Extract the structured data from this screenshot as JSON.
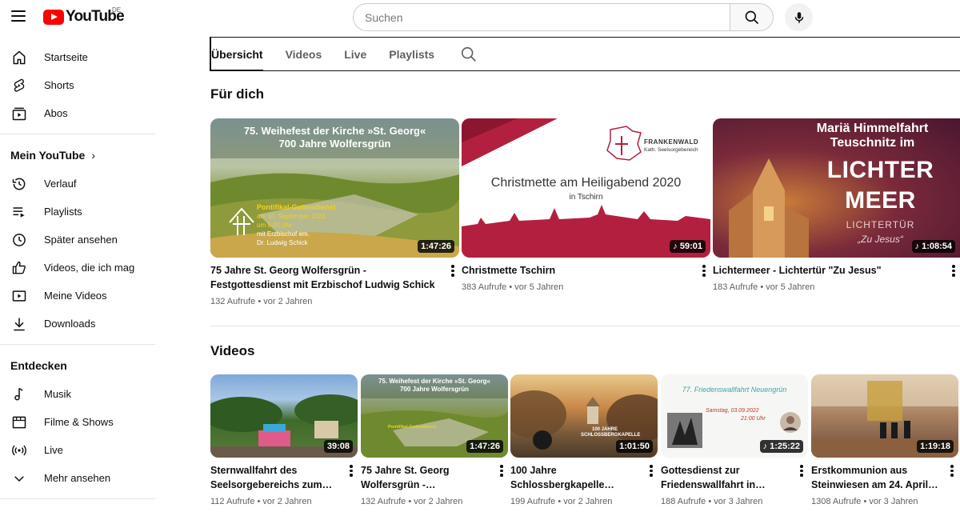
{
  "header": {
    "logo_text": "YouTube",
    "region": "DE",
    "search_placeholder": "Suchen"
  },
  "sidebar": {
    "main": [
      {
        "label": "Startseite",
        "icon": "home-icon"
      },
      {
        "label": "Shorts",
        "icon": "shorts-icon"
      },
      {
        "label": "Abos",
        "icon": "subscriptions-icon"
      }
    ],
    "you_heading": "Mein YouTube",
    "you_items": [
      {
        "label": "Verlauf",
        "icon": "history-icon"
      },
      {
        "label": "Playlists",
        "icon": "playlists-icon"
      },
      {
        "label": "Später ansehen",
        "icon": "watch-later-icon"
      },
      {
        "label": "Videos, die ich mag",
        "icon": "thumbs-up-icon"
      },
      {
        "label": "Meine Videos",
        "icon": "my-videos-icon"
      },
      {
        "label": "Downloads",
        "icon": "download-icon"
      }
    ],
    "explore_heading": "Entdecken",
    "explore_items": [
      {
        "label": "Musik",
        "icon": "music-icon"
      },
      {
        "label": "Filme & Shows",
        "icon": "film-icon"
      },
      {
        "label": "Live",
        "icon": "live-icon"
      },
      {
        "label": "Mehr ansehen",
        "icon": "chevron-down-icon"
      }
    ]
  },
  "tabs": [
    "Übersicht",
    "Videos",
    "Live",
    "Playlists"
  ],
  "for_you": {
    "title": "Für dich",
    "videos": [
      {
        "title": "75 Jahre St. Georg Wolfersgrün - Festgottesdienst mit Erzbischof Ludwig Schick",
        "meta": "132 Aufrufe • vor 2 Jahren",
        "duration": "1:47:26",
        "thumb_lines": [
          "75. Weihefest der Kirche »St. Georg«",
          "700 Jahre Wolfersgrün"
        ],
        "thumb_sub": [
          "Pontifikal-Gottesdienst",
          "am 10. September 2023",
          "um 9.00 Uhr",
          "mit Erzbischof em.",
          "Dr. Ludwig Schick"
        ]
      },
      {
        "title": "Christmette Tschirn",
        "meta": "383 Aufrufe • vor 5 Jahren",
        "duration": "59:01",
        "thumb_lines": [
          "Christmette am Heiligabend 2020",
          "in Tschirn"
        ],
        "thumb_sub": [
          "FRANKENWALD",
          "Kath. Seelsorgebereich"
        ]
      },
      {
        "title": "Lichtermeer - Lichtertür \"Zu Jesus\"",
        "meta": "183 Aufrufe • vor 5 Jahren",
        "duration": "1:08:54",
        "thumb_lines": [
          "Mariä Himmelfahrt",
          "Teuschnitz  im",
          "LICHTER",
          "MEER"
        ],
        "thumb_sub": [
          "LICHTERTÜR",
          "„Zu Jesus“"
        ]
      }
    ]
  },
  "videos_section": {
    "title": "Videos",
    "videos": [
      {
        "title": "Sternwallfahrt des Seelsorgebereichs zum…",
        "meta": "112 Aufrufe • vor 2 Jahren",
        "duration": "39:08"
      },
      {
        "title": "75 Jahre St. Georg Wolfersgrün -…",
        "meta": "132 Aufrufe • vor 2 Jahren",
        "duration": "1:47:26"
      },
      {
        "title": "100 Jahre Schlossbergkapelle…",
        "meta": "199 Aufrufe • vor 2 Jahren",
        "duration": "1:01:50",
        "thumb_text": "100 JAHRE SCHLOSSBERGKAPELLE"
      },
      {
        "title": "Gottesdienst zur Friedenswallfahrt in…",
        "meta": "188 Aufrufe • vor 3 Jahren",
        "duration": "1:25:22",
        "thumb_text": "77. Friedenswallfahrt Neuengrün",
        "thumb_date": "Samstag, 03.09.2022",
        "thumb_time": "21:00 Uhr"
      },
      {
        "title": "Erstkommunion aus Steinwiesen am 24. April…",
        "meta": "1308 Aufrufe • vor 3 Jahren",
        "duration": "1:19:18"
      }
    ]
  },
  "colors": {
    "brand": "#ff0000",
    "christmette": "#b3203f",
    "lichtermeer": "#6e1f3f"
  }
}
